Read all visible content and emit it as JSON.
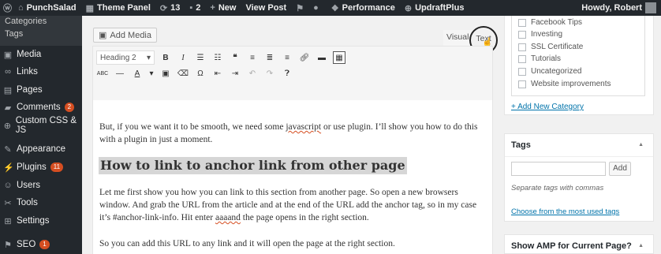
{
  "admin_bar": {
    "site_name": "PunchSalad",
    "theme_panel": "Theme Panel",
    "updates_count": "13",
    "comments_count": "2",
    "new_label": "New",
    "view_post": "View Post",
    "performance": "Performance",
    "updraft": "UpdraftPlus",
    "howdy": "Howdy, Robert"
  },
  "sidebar": {
    "sub_items": [
      "Categories",
      "Tags"
    ],
    "items": [
      {
        "label": "Media",
        "icon": "media-icon"
      },
      {
        "label": "Links",
        "icon": "links-icon"
      },
      {
        "label": "Pages",
        "icon": "pages-icon"
      },
      {
        "label": "Comments",
        "icon": "comments-icon",
        "badge": "2"
      },
      {
        "label": "Custom CSS & JS",
        "icon": "plus-circle-icon"
      },
      {
        "label": "Appearance",
        "icon": "appearance-icon"
      },
      {
        "label": "Plugins",
        "icon": "plugins-icon",
        "badge": "11"
      },
      {
        "label": "Users",
        "icon": "users-icon"
      },
      {
        "label": "Tools",
        "icon": "tools-icon"
      },
      {
        "label": "Settings",
        "icon": "settings-icon"
      },
      {
        "label": "SEO",
        "icon": "seo-icon",
        "badge": "1"
      }
    ]
  },
  "editor": {
    "add_media": "Add Media",
    "tab_visual": "Visual",
    "tab_text": "Text",
    "format_select": "Heading 2",
    "para1": "But, if you we want it to be smooth, we need some ",
    "para1_sq": "javascript",
    "para1_rest": " or use plugin. I’ll show you how to do this with a plugin in just a moment.",
    "heading": "How to link to anchor link from other page",
    "para2a": "Let me first show you how you can link to this section from another page. So open a new browsers window. And grab the URL from the article and at the end of the URL add the anchor tag, so in my case it’s #anchor-link-info. Hit enter ",
    "para2_sq": "aaaand",
    "para2b": " the page opens in the right section.",
    "para3": "So you can add this URL to any link and it will open the page at the right section."
  },
  "categories": {
    "items": [
      "Facebook Tips",
      "Investing",
      "SSL Certificate",
      "Tutorials",
      "Uncategorized",
      "Website improvements"
    ],
    "add_new": "+ Add New Category"
  },
  "tags_box": {
    "title": "Tags",
    "add_button": "Add",
    "help": "Separate tags with commas",
    "most_used": "Choose from the most used tags"
  },
  "amp_box": {
    "title": "Show AMP for Current Page?"
  },
  "colors": {
    "admin_dark": "#23282d",
    "badge": "#d54e21",
    "link": "#0073aa"
  }
}
